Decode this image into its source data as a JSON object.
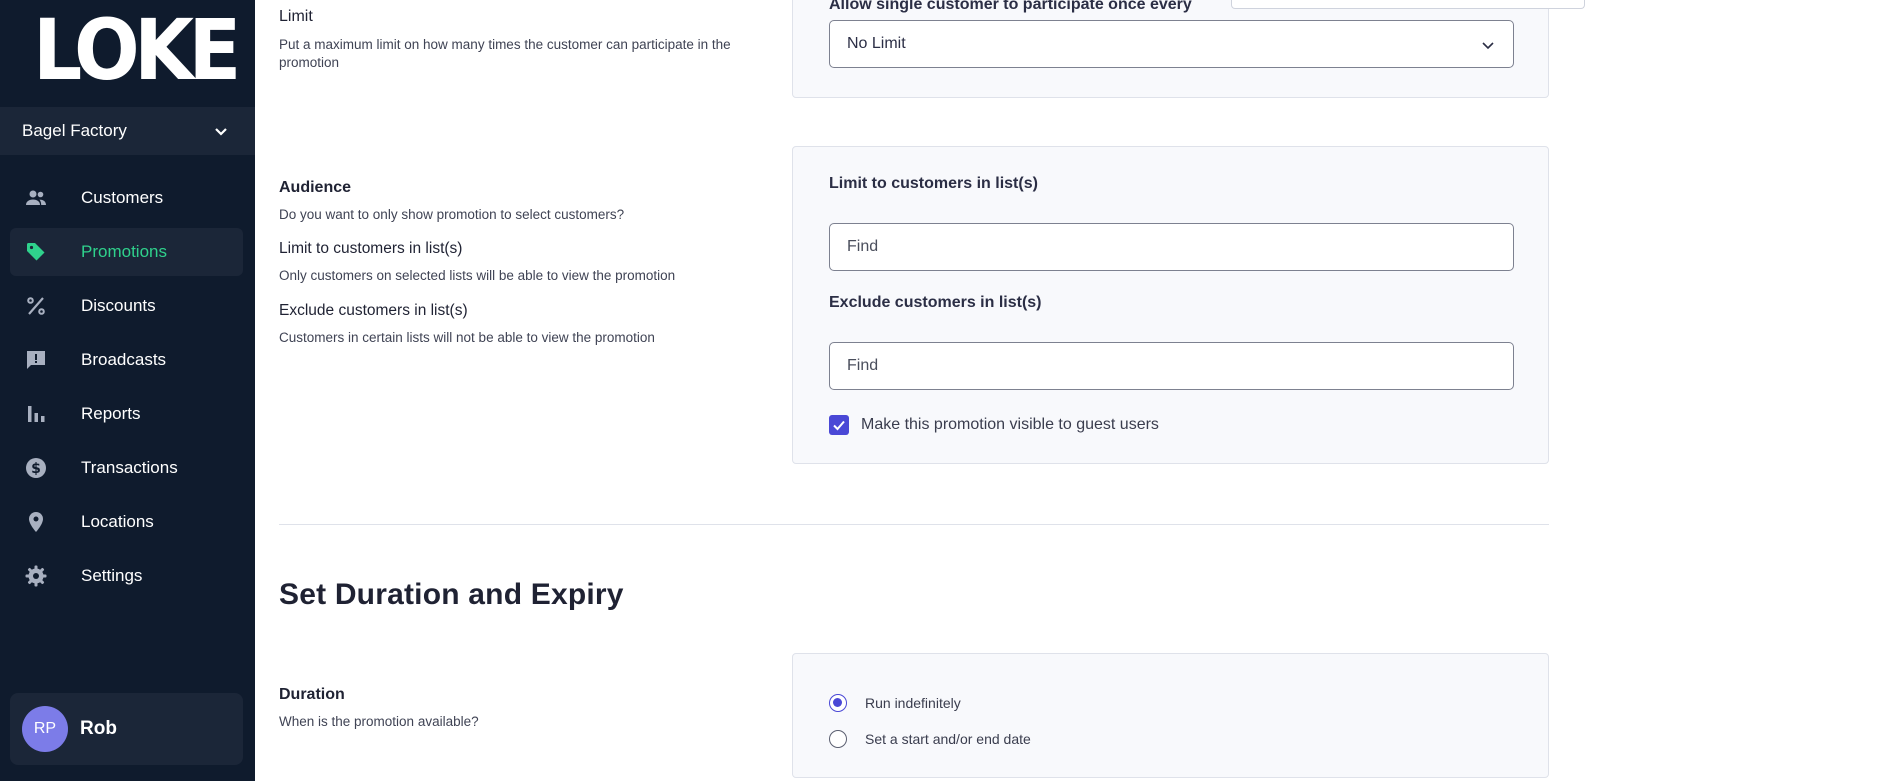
{
  "sidebar": {
    "logo": "LOKE",
    "store": "Bagel Factory",
    "items": [
      {
        "label": "Customers",
        "icon": "people-icon"
      },
      {
        "label": "Promotions",
        "icon": "tag-icon"
      },
      {
        "label": "Discounts",
        "icon": "percent-icon"
      },
      {
        "label": "Broadcasts",
        "icon": "chat-alert-icon"
      },
      {
        "label": "Reports",
        "icon": "bar-chart-icon"
      },
      {
        "label": "Transactions",
        "icon": "dollar-icon"
      },
      {
        "label": "Locations",
        "icon": "location-pin-icon"
      },
      {
        "label": "Settings",
        "icon": "gear-icon"
      }
    ],
    "user": {
      "initials": "RP",
      "name": "Rob"
    }
  },
  "limit": {
    "title": "Limit",
    "description": "Put a maximum limit on how many times the customer can participate in the promotion",
    "field_label": "Allow single customer to participate once every",
    "value": "No Limit"
  },
  "audience": {
    "title": "Audience",
    "description": "Do you want to only show promotion to select customers?",
    "limit_title": "Limit to customers in list(s)",
    "limit_description": "Only customers on selected lists will be able to view the promotion",
    "exclude_title": "Exclude customers in list(s)",
    "exclude_description": "Customers in certain lists will not be able to view the promotion",
    "limit_field_label": "Limit to customers in list(s)",
    "limit_placeholder": "Find",
    "exclude_field_label": "Exclude customers in list(s)",
    "exclude_placeholder": "Find",
    "guest_checkbox_label": "Make this promotion visible to guest users",
    "guest_checked": true
  },
  "duration_section": {
    "heading": "Set Duration and Expiry",
    "title": "Duration",
    "description": "When is the promotion available?",
    "options": [
      "Run indefinitely",
      "Set a start and/or end date"
    ],
    "selected": "Run indefinitely"
  },
  "colors": {
    "sidebar_bg": "#0f1b2d",
    "active_item": "#2fd18c",
    "accent": "#4a48d6",
    "avatar": "#7c7ce8"
  }
}
